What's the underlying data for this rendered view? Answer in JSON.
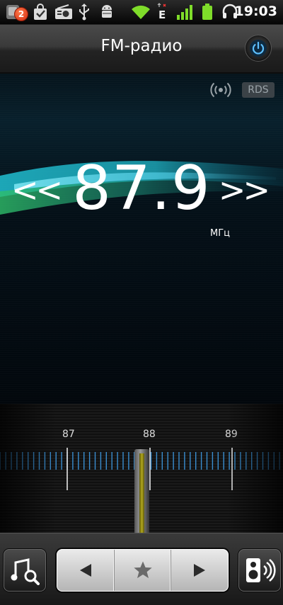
{
  "status_bar": {
    "notification_count": "2",
    "clock": "19:03",
    "network_type": "E",
    "icons": [
      "notification-icon",
      "shopping-bag-icon",
      "radio-icon",
      "usb-icon",
      "android-debug-icon",
      "wifi-icon",
      "network-e-icon",
      "signal-icon",
      "battery-icon",
      "headset-icon"
    ]
  },
  "header": {
    "title": "FM-радио",
    "power_icon": "power-icon"
  },
  "display": {
    "rds_label": "RDS",
    "frequency": "87.9",
    "unit": "МГц",
    "seek_back": "<<",
    "seek_forward": ">>"
  },
  "tuner": {
    "labels": [
      "87",
      "88",
      "89"
    ],
    "position": 87.9
  },
  "controls": {
    "left_icon": "music-search-icon",
    "prev_icon": "prev-triangle-icon",
    "favorite_icon": "star-icon",
    "next_icon": "next-triangle-icon",
    "right_icon": "speaker-icon"
  },
  "colors": {
    "accent_wave": "#1fb6c8",
    "needle": "#b2a820",
    "power_ring": "#3aa4e8"
  }
}
